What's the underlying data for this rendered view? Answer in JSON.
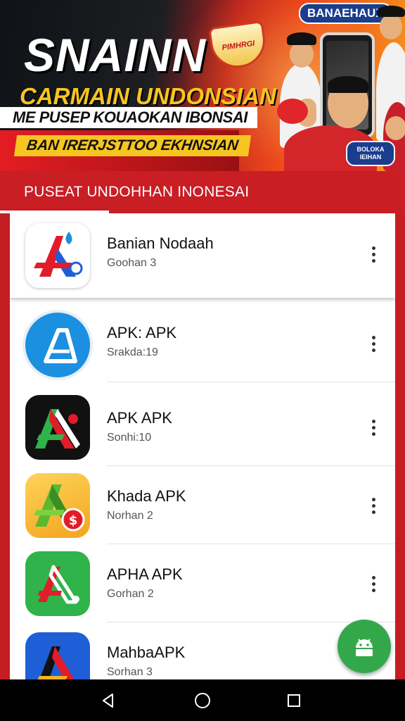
{
  "banner": {
    "title": "SNAINN",
    "badge_text": "PIMHRGI",
    "subtitle_1": "CARMAIN UNDONSIAN",
    "subtitle_2": "ME PUSEP KOUAOKAN IBONSAI",
    "subtitle_3": "BAN IRERJSTTOO EKHNSIAN",
    "corner_label": "BANAEHAUX",
    "seal_text": "BOLOKA IEIHAN"
  },
  "header": {
    "title": "PUSEAT UNDOHHAN INONESAI"
  },
  "apps": [
    {
      "name": "Banian Nodaah",
      "sub": "Goohan 3",
      "icon": "red-blue-a-logo-icon"
    },
    {
      "name": "APK: APK",
      "sub": "Srakda:19",
      "icon": "blue-a-circle-icon"
    },
    {
      "name": "APK APK",
      "sub": "Sonhi:10",
      "icon": "black-green-red-a-icon"
    },
    {
      "name": "Khada APK",
      "sub": "Norhan 2",
      "icon": "yellow-green-a-dollar-icon"
    },
    {
      "name": "APHA APK",
      "sub": "Gorhan 2",
      "icon": "green-red-a-icon"
    },
    {
      "name": "MahbaAPK",
      "sub": "Sorhan 3",
      "icon": "blue-red-a-icon"
    }
  ],
  "fab": {
    "icon": "android-robot-icon"
  },
  "navbar": {
    "back_icon": "back-triangle-icon",
    "home_icon": "home-circle-icon",
    "recents_icon": "recents-square-icon"
  },
  "colors": {
    "brand_red": "#c81e24",
    "fab_green": "#33a84a",
    "gold": "#f7c51f"
  }
}
